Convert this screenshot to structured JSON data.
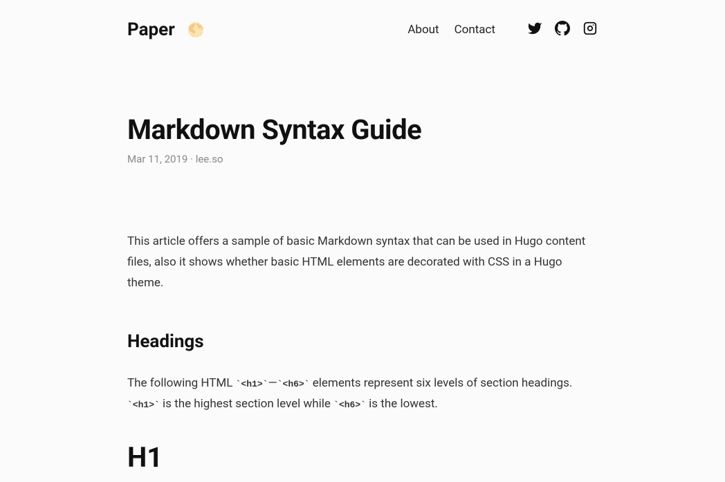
{
  "header": {
    "site_title": "Paper",
    "theme_icon": "🌕",
    "nav": {
      "about": "About",
      "contact": "Contact"
    },
    "social": {
      "twitter": "twitter-icon",
      "github": "github-icon",
      "instagram": "instagram-icon"
    }
  },
  "post": {
    "title": "Markdown Syntax Guide",
    "date": "Mar 11, 2019",
    "meta_separator": " · ",
    "author": "lee.so",
    "intro": "This article offers a sample of basic Markdown syntax that can be used in Hugo content files, also it shows whether basic HTML elements are decorated with CSS in a Hugo theme.",
    "h2_headings": "Headings",
    "headings_para_1": "The following HTML ",
    "code_h1_open": "`<h1>`",
    "headings_para_2": "—",
    "code_h6_open": "`<h6>`",
    "headings_para_3": " elements represent six levels of section headings. ",
    "code_h1_open2": "`<h1>`",
    "headings_para_4": " is the highest section level while ",
    "code_h6_open2": "`<h6>`",
    "headings_para_5": " is the lowest.",
    "h1_sample": "H1"
  }
}
